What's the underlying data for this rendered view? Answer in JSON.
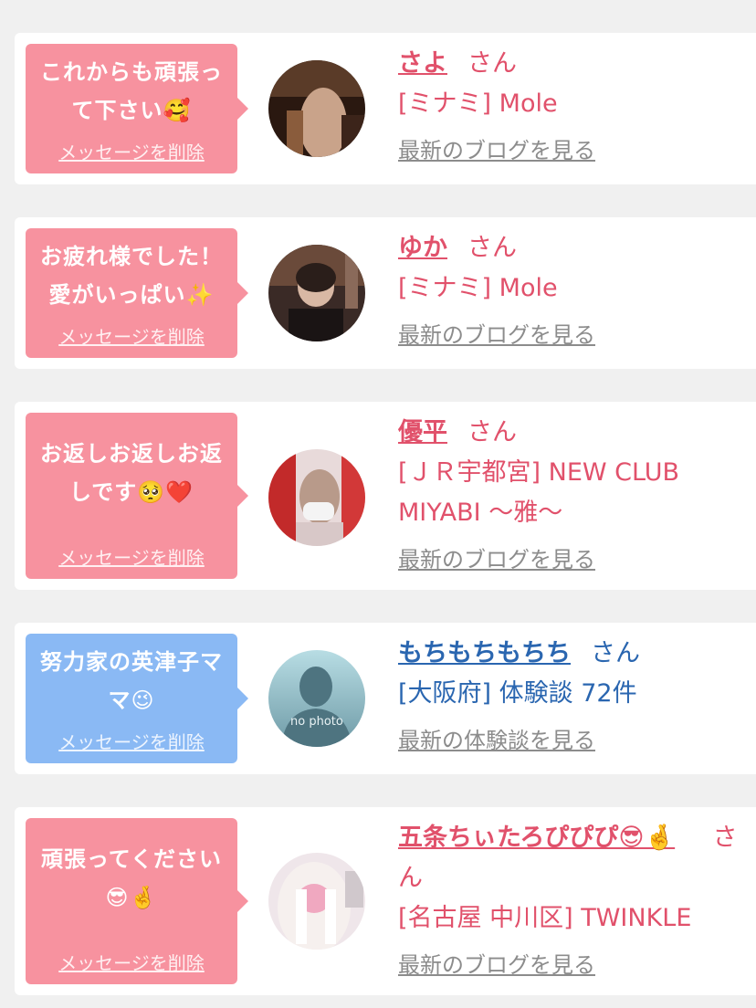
{
  "delete_label": "メッセージを削除",
  "san": "さん",
  "cards": [
    {
      "bubble_lines": [
        "これからも頑張っ",
        "て下さい🥰"
      ],
      "name": "さよ",
      "shop": "[ミナミ] Mole",
      "more": "最新のブログを見る",
      "theme": "pink"
    },
    {
      "bubble_lines": [
        "お疲れ様でした！",
        "愛がいっぱい✨"
      ],
      "name": "ゆか",
      "shop": "[ミナミ] Mole",
      "more": "最新のブログを見る",
      "theme": "pink"
    },
    {
      "bubble_lines": [
        "お返しお返しお返",
        "しです🥺❤️"
      ],
      "name": "優平",
      "shop_lines": [
        "[ＪＲ宇都宮] NEW CLUB",
        "MIYABI 〜雅〜"
      ],
      "more": "最新のブログを見る",
      "theme": "pink"
    },
    {
      "bubble_lines": [
        "努力家の英津子マ",
        "マ😉"
      ],
      "name": "もちもちもちち",
      "shop": "[大阪府] 体験談 72件",
      "more": "最新の体験談を見る",
      "theme": "blue",
      "avatar_text": "no photo"
    },
    {
      "bubble_lines": [
        "頑張ってください",
        "😎🤞"
      ],
      "name": "五条ちぃたろぴぴぴ😎🤞",
      "name_suffix_wrap": [
        "さ",
        "ん"
      ],
      "shop": "[名古屋 中川区] TWINKLE",
      "more": "最新のブログを見る",
      "theme": "pink"
    }
  ],
  "colors": {
    "pink_bubble": "#f7929f",
    "blue_bubble": "#8ab9f4",
    "pink_text": "#e1516b",
    "blue_text": "#2a66b0",
    "link_gray": "#8c8c8c"
  }
}
